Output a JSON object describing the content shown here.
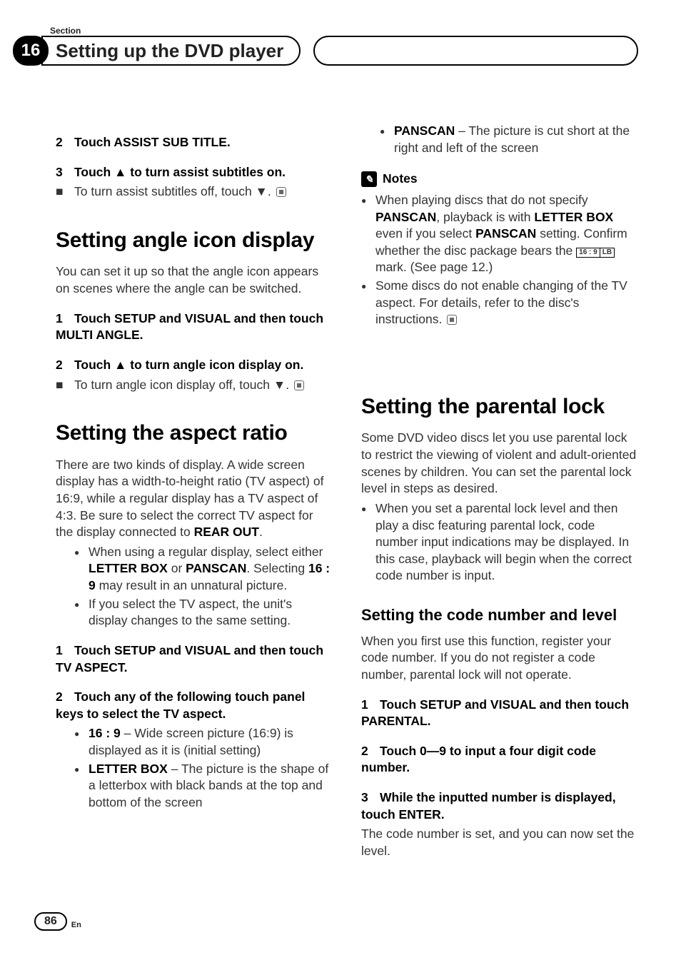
{
  "header": {
    "section_label": "Section",
    "chapter_number": "16",
    "chapter_title": "Setting up the DVD player"
  },
  "left": {
    "step2": {
      "num": "2",
      "text": "Touch ASSIST SUB TITLE."
    },
    "step3": {
      "num": "3",
      "text": "Touch ▲ to turn assist subtitles on."
    },
    "step3_sub": "To turn assist subtitles off, touch ▼.",
    "h1a": "Setting angle icon display",
    "p_a": "You can set it up so that the angle icon appears on scenes where the angle can be switched.",
    "stepA1": {
      "num": "1",
      "text": "Touch SETUP and VISUAL and then touch MULTI ANGLE."
    },
    "stepA2": {
      "num": "2",
      "text": "Touch ▲ to turn angle icon display on."
    },
    "stepA2_sub": "To turn angle icon display off, touch ▼.",
    "h1b": "Setting the aspect ratio",
    "p_b1_pre": "There are two kinds of display. A wide screen display has a width-to-height ratio (TV aspect) of 16:9, while a regular display has a TV aspect of 4:3. Be sure to select the correct TV aspect for the display connected to ",
    "p_b1_rear": "REAR OUT",
    "p_b1_post": ".",
    "bul_b1_pre": "When using a regular display, select either ",
    "bul_b1_lb": "LETTER BOX",
    "bul_b1_mid": " or ",
    "bul_b1_ps": "PANSCAN",
    "bul_b1_post1": ". Selecting ",
    "bul_b1_169": "16 : 9",
    "bul_b1_post2": " may result in an unnatural picture.",
    "bul_b2": "If you select the TV aspect, the unit's display changes to the same setting.",
    "stepB1": {
      "num": "1",
      "text": "Touch SETUP and VISUAL and then touch TV ASPECT."
    },
    "stepB2": {
      "num": "2",
      "text": "Touch any of the following touch panel keys to select the TV aspect."
    },
    "opt1_k": "16 : 9",
    "opt1_v": " – Wide screen picture (16:9) is displayed as it is (initial setting)",
    "opt2_k": "LETTER BOX",
    "opt2_v": " – The picture is the shape of a letterbox with black bands at the top and bottom of the screen"
  },
  "right": {
    "opt3_k": "PANSCAN",
    "opt3_v": " – The picture is cut short at the right and left of the screen",
    "notes_label": "Notes",
    "note1_pre": "When playing discs that do not specify ",
    "note1_ps": "PANSCAN",
    "note1_mid1": ", playback is with ",
    "note1_lb": "LETTER BOX",
    "note1_mid2": " even if you select ",
    "note1_ps2": "PANSCAN",
    "note1_mid3": " setting. Confirm whether the disc package bears the ",
    "note1_mark_a": "16 : 9",
    "note1_mark_b": "LB",
    "note1_post": " mark. (See page 12.)",
    "note2": "Some discs do not enable changing of the TV aspect. For details, refer to the disc's instructions.",
    "h1c": "Setting the parental lock",
    "p_c": "Some DVD video discs let you use parental lock to restrict the viewing of violent and adult-oriented scenes by children. You can set the parental lock level in steps as desired.",
    "bul_c": "When you set a parental lock level and then play a disc featuring parental lock, code number input indications may be displayed. In this case, playback will begin when the correct code number is input.",
    "h2c": "Setting the code number and level",
    "p_c2": "When you first use this function, register your code number. If you do not register a code number, parental lock will not operate.",
    "stepC1": {
      "num": "1",
      "text": "Touch SETUP and VISUAL and then touch PARENTAL."
    },
    "stepC2": {
      "num": "2",
      "text": "Touch 0—9 to input a four digit code number."
    },
    "stepC3": {
      "num": "3",
      "text": "While the inputted number is displayed, touch ENTER."
    },
    "p_c3": "The code number is set, and you can now set the level."
  },
  "footer": {
    "page": "86",
    "lang": "En"
  }
}
